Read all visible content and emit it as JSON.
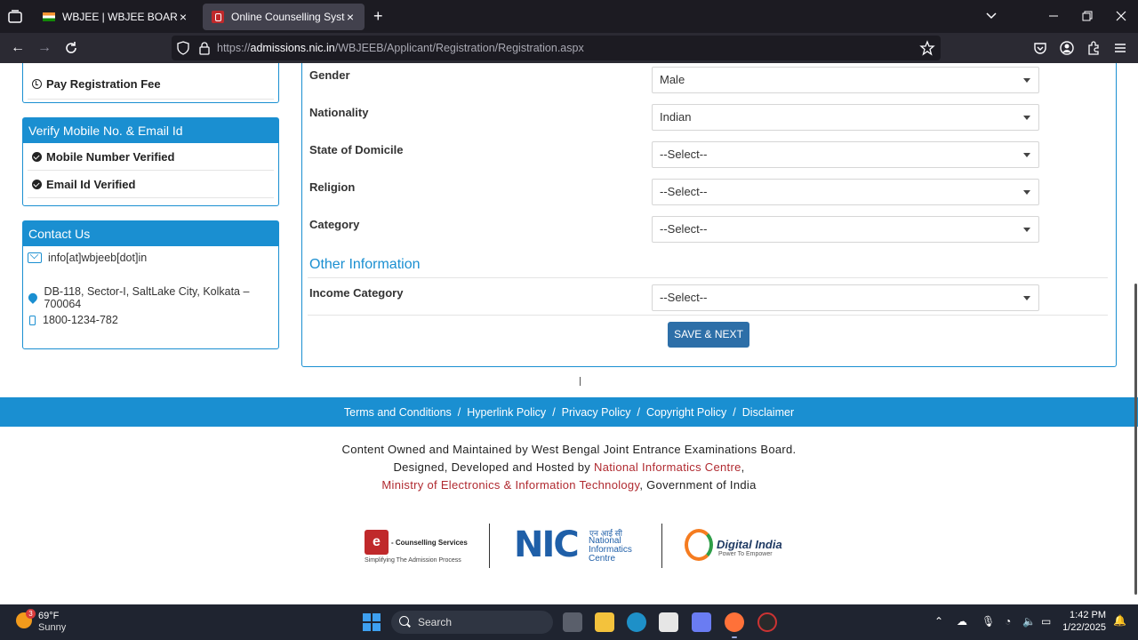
{
  "browser": {
    "tabs": [
      {
        "title": "WBJEE | WBJEE BOARD | India",
        "active": false
      },
      {
        "title": "Online Counselling System",
        "active": true
      }
    ],
    "url": {
      "prefix": "https://",
      "host": "admissions.nic.in",
      "path": "/WBJEEB/Applicant/Registration/Registration.aspx"
    }
  },
  "sidebar": {
    "pay_fee_label": "Pay Registration Fee",
    "verify_panel": {
      "title": "Verify Mobile No. & Email Id",
      "items": [
        "Mobile Number Verified",
        "Email Id Verified"
      ]
    },
    "contact_panel": {
      "title": "Contact Us",
      "email": "info[at]wbjeeb[dot]in",
      "address": "DB-118, Sector-I, SaltLake City, Kolkata – 700064",
      "phone": "1800-1234-782"
    }
  },
  "form": {
    "fields": [
      {
        "label": "Gender",
        "value": "Male"
      },
      {
        "label": "Nationality",
        "value": "Indian"
      },
      {
        "label": "State of Domicile",
        "value": "--Select--"
      },
      {
        "label": "Religion",
        "value": "--Select--"
      },
      {
        "label": "Category",
        "value": "--Select--"
      }
    ],
    "other_section_title": "Other Information",
    "income": {
      "label": "Income Category",
      "value": "--Select--"
    },
    "save_button": "SAVE & NEXT"
  },
  "footer": {
    "links": [
      "Terms and Conditions",
      "Hyperlink Policy",
      "Privacy Policy",
      "Copyright Policy",
      "Disclaimer"
    ],
    "link_separator": "/",
    "line1": "Content Owned and Maintained by West Bengal Joint Entrance Examinations Board.",
    "line2_prefix": "Designed, Developed and Hosted by ",
    "line2_link": "National Informatics Centre",
    "line2_suffix": ",",
    "line3_link": "Ministry of Electronics & Information Technology",
    "line3_suffix": ", Government of India",
    "logos": {
      "ec_mark": "e",
      "ec_name": "- Counselling Services",
      "ec_tag": "Simplifying The Admission Process",
      "nic_mark": "NIC",
      "nic_hindi": "एन आई सी",
      "nic_sub": "National Informatics Centre",
      "di_name": "Digital India",
      "di_tag": "Power To Empower"
    }
  },
  "taskbar": {
    "weather_temp": "69°F",
    "weather_cond": "Sunny",
    "weather_badge": "3",
    "search_placeholder": "Search",
    "time": "1:42 PM",
    "date": "1/22/2025"
  },
  "colors": {
    "accent": "#1a8fd1",
    "button": "#2d6fa8",
    "footer_link_red": "#b02a30"
  }
}
